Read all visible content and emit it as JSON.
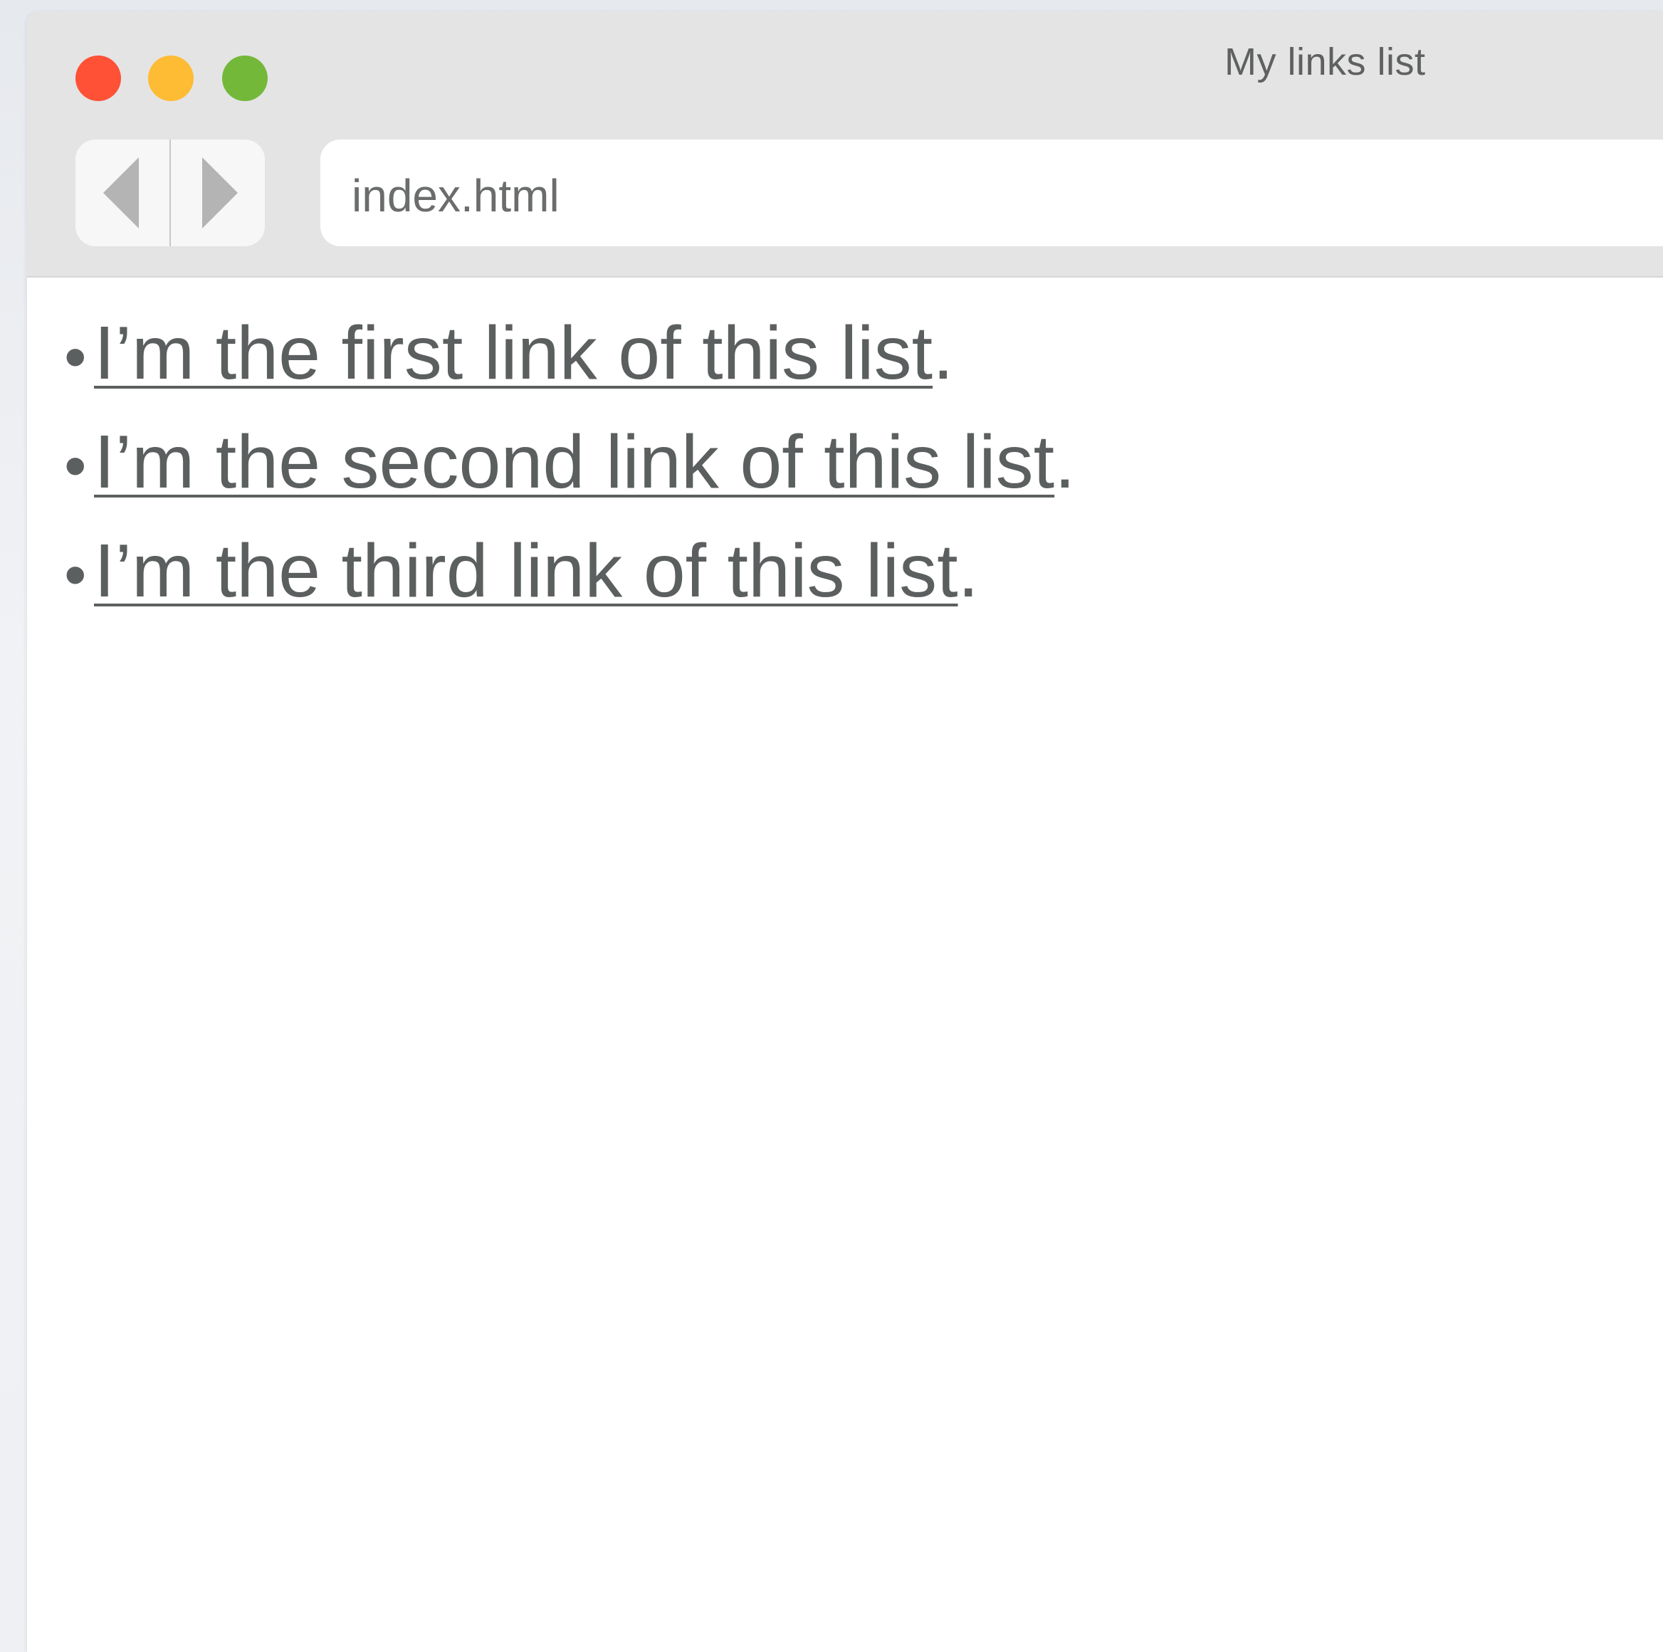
{
  "window": {
    "title": "My links list",
    "controls": {
      "close_color": "#fe5135",
      "minimize_color": "#febb34",
      "maximize_color": "#74b83a"
    }
  },
  "toolbar": {
    "back_icon": "triangle-left-icon",
    "forward_icon": "triangle-right-icon",
    "address": "index.html"
  },
  "content": {
    "links": [
      {
        "text": "I’m the first link of this list",
        "suffix": "."
      },
      {
        "text": "I’m the second link of this list",
        "suffix": "."
      },
      {
        "text": "I’m the third link of this list",
        "suffix": "."
      }
    ],
    "bullet": "•"
  }
}
